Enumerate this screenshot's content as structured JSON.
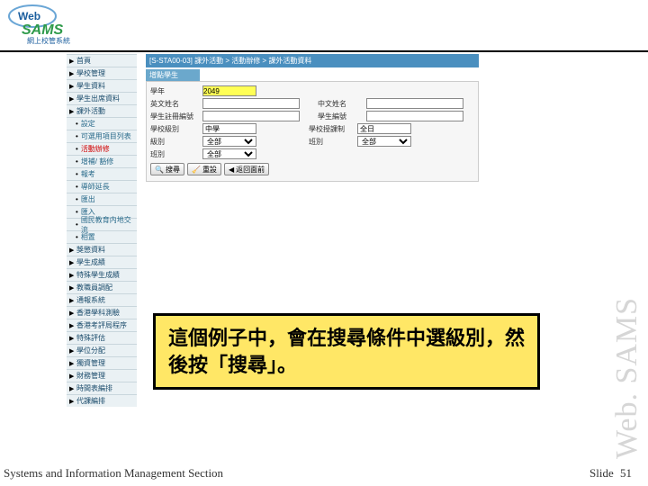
{
  "logo": {
    "line1": "Web",
    "line2": "SAMS",
    "tag": "網上校管系統"
  },
  "nav": [
    {
      "label": "首頁",
      "sub": false
    },
    {
      "label": "學校管理",
      "sub": false
    },
    {
      "label": "學生資料",
      "sub": false
    },
    {
      "label": "學生出席資料",
      "sub": false
    },
    {
      "label": "課外活動",
      "sub": false
    },
    {
      "label": "設定",
      "sub": true
    },
    {
      "label": "可選用項目列表",
      "sub": true
    },
    {
      "label": "活動辦修",
      "sub": true,
      "active": true
    },
    {
      "label": "增補/ 豁修",
      "sub": true
    },
    {
      "label": "報考",
      "sub": true
    },
    {
      "label": "導師延長",
      "sub": true
    },
    {
      "label": "匯出",
      "sub": true
    },
    {
      "label": "匯入",
      "sub": true
    },
    {
      "label": "國民教育内地交流",
      "sub": true
    },
    {
      "label": "相置",
      "sub": true
    },
    {
      "label": "獎懲資料",
      "sub": false
    },
    {
      "label": "學生成績",
      "sub": false
    },
    {
      "label": "特殊學生成績",
      "sub": false
    },
    {
      "label": "教職員調配",
      "sub": false
    },
    {
      "label": "通報系統",
      "sub": false
    },
    {
      "label": "香港學科測驗",
      "sub": false
    },
    {
      "label": "香港考評局程序",
      "sub": false
    },
    {
      "label": "特殊評估",
      "sub": false
    },
    {
      "label": "學位分配",
      "sub": false
    },
    {
      "label": "獨資管理",
      "sub": false
    },
    {
      "label": "財務管理",
      "sub": false
    },
    {
      "label": "時間表編排",
      "sub": false
    },
    {
      "label": "代課編排",
      "sub": false
    }
  ],
  "breadcrumb": "[S-STA00-03] 課外活動 > 活動辦修 > 課外活動資料",
  "panel_title": "增點學生",
  "form": {
    "labels": {
      "year": "學年",
      "name_en": "英文姓名",
      "reg": "學生註冊編號",
      "level": "學校級別",
      "class_level": "級別",
      "name_zh": "中文姓名",
      "num": "學生編號",
      "section": "學校授課制",
      "class": "班別"
    },
    "values": {
      "year": "2049",
      "level_sel": "中學",
      "section_sel": "全日",
      "class_level_sel": "全部",
      "class_sel": "全部"
    },
    "buttons": {
      "search": "搜尋",
      "reset": "重設",
      "back": "返回面前"
    }
  },
  "callout_text": "這個例子中，會在搜尋條件中選級別，然後按「搜尋」。",
  "side_brand": "Web. SAMS",
  "footer": {
    "left": "Systems and Information Management Section",
    "slide_label": "Slide",
    "slide_num": "51"
  }
}
